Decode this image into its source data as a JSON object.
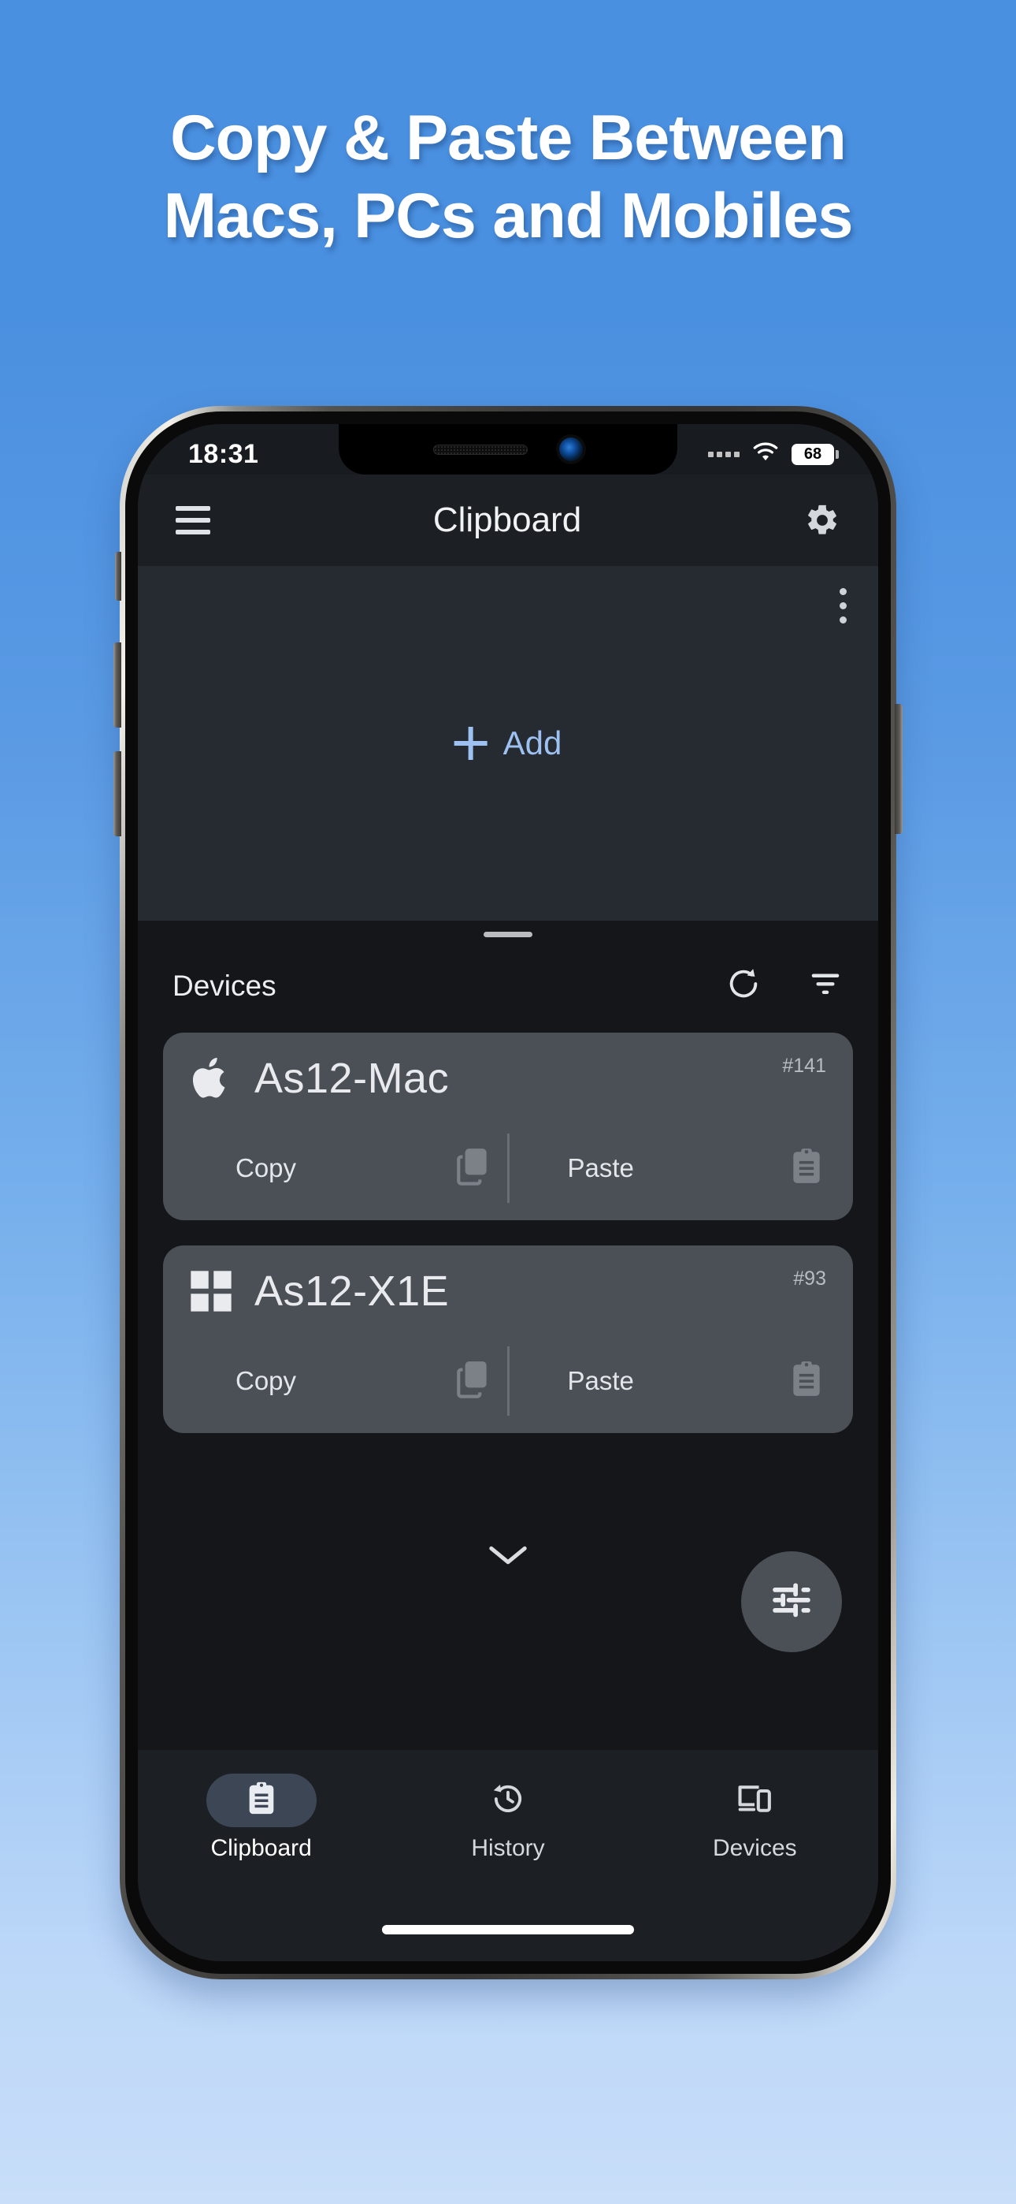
{
  "promo": {
    "headline_line1": "Copy & Paste Between",
    "headline_line2": "Macs, PCs and Mobiles",
    "bg_top_color": "#4a90e0",
    "bg_bottom_color": "#c8def9",
    "headline_color": "#ffffff"
  },
  "status_bar": {
    "time": "18:31",
    "wifi_icon": "wifi-icon",
    "signal_icon": "signal-dots-icon",
    "battery_level": "68"
  },
  "app_bar": {
    "menu_icon": "hamburger-menu-icon",
    "title": "Clipboard",
    "settings_icon": "gear-icon"
  },
  "clipboard_panel": {
    "overflow_icon": "kebab-menu-icon",
    "add_label": "Add",
    "add_icon": "plus-icon",
    "accent_color": "#9dc2f2",
    "background_color": "#262a31"
  },
  "devices_sheet": {
    "title": "Devices",
    "refresh_icon": "refresh-icon",
    "filter_icon": "filter-icon",
    "expand_icon": "chevron-down-icon",
    "fab_icon": "tune-sliders-icon",
    "card_color": "#4b4f56",
    "devices": [
      {
        "platform_icon": "apple-logo-icon",
        "name": "As12-Mac",
        "id": "#141",
        "copy_label": "Copy",
        "copy_icon": "copy-icon",
        "paste_label": "Paste",
        "paste_icon": "clipboard-paste-icon"
      },
      {
        "platform_icon": "windows-logo-icon",
        "name": "As12-X1E",
        "id": "#93",
        "copy_label": "Copy",
        "copy_icon": "copy-icon",
        "paste_label": "Paste",
        "paste_icon": "clipboard-paste-icon"
      }
    ]
  },
  "bottom_nav": {
    "active_index": 0,
    "active_pill_color": "#3c4654",
    "items": [
      {
        "label": "Clipboard",
        "icon": "clipboard-icon"
      },
      {
        "label": "History",
        "icon": "history-clock-icon"
      },
      {
        "label": "Devices",
        "icon": "devices-icon"
      }
    ]
  }
}
